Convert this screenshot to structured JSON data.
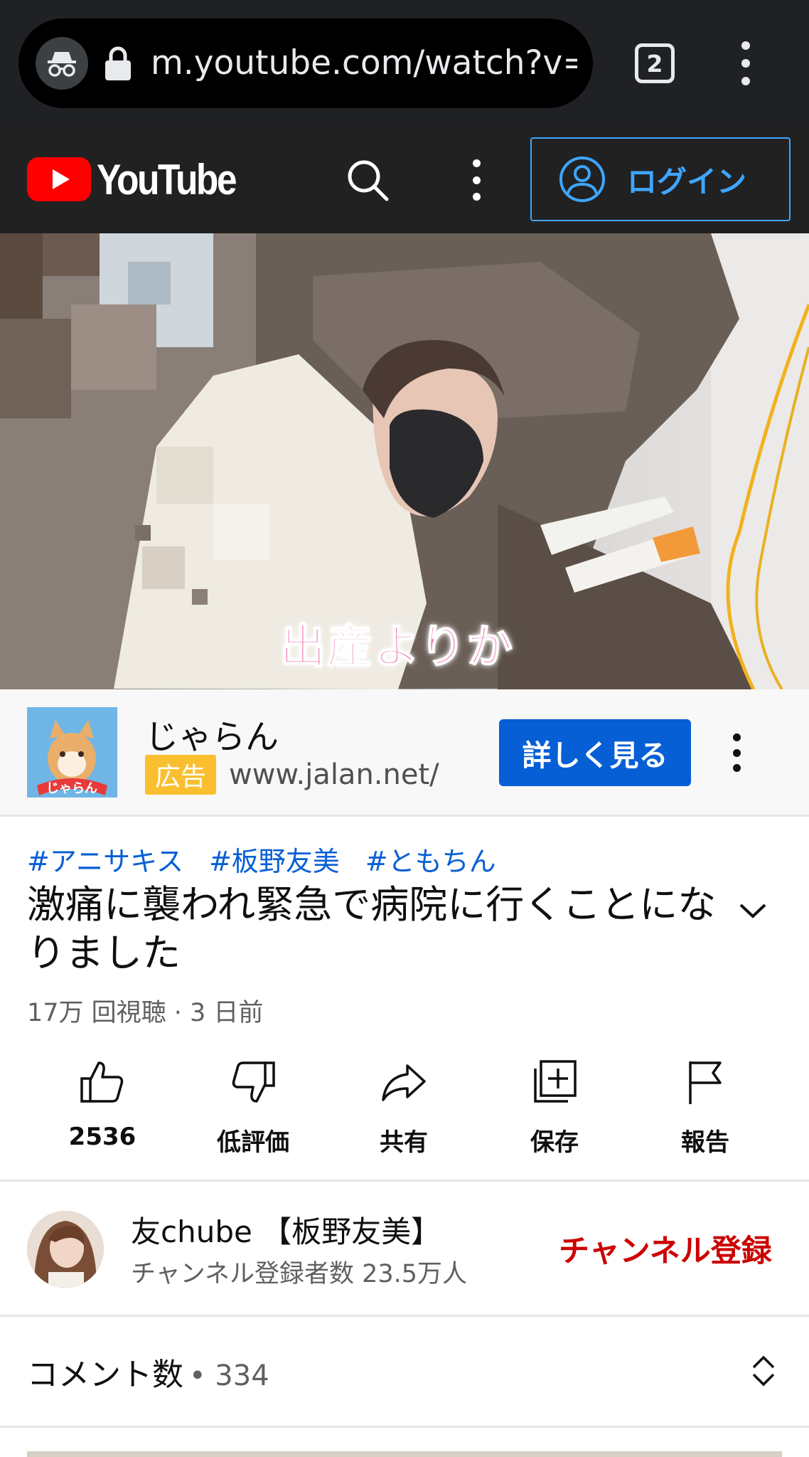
{
  "browser": {
    "url": "m.youtube.com/watch?v=h",
    "tab_count": "2",
    "icons": [
      "incognito-icon",
      "lock-icon",
      "tab-switcher-icon",
      "more-vert-icon"
    ]
  },
  "header": {
    "logo_text": "YouTube",
    "login_label": "ログイン",
    "accent": "#3ea6ff",
    "brand_red": "#ff0000"
  },
  "video": {
    "caption": "出産よりか"
  },
  "ad": {
    "title": "じゃらん",
    "badge": "広告",
    "url": "www.jalan.net/",
    "cta_label": "詳しく見る",
    "thumb_text": "じゃらん"
  },
  "info": {
    "hashtags": [
      "#アニサキス",
      "#板野友美",
      "#ともちん"
    ],
    "title": "激痛に襲われ緊急で病院に行くことになりました",
    "meta": "17万 回視聴 · 3 日前"
  },
  "actions": [
    {
      "icon": "like-icon",
      "label": "2536"
    },
    {
      "icon": "dislike-icon",
      "label": "低評価"
    },
    {
      "icon": "share-icon",
      "label": "共有"
    },
    {
      "icon": "save-icon",
      "label": "保存"
    },
    {
      "icon": "report-icon",
      "label": "報告"
    }
  ],
  "channel": {
    "name": "友chube 【板野友美】",
    "subscribers": "チャンネル登録者数 23.5万人",
    "subscribe_label": "チャンネル登録"
  },
  "comments": {
    "label": "コメント数",
    "count": "• 334"
  }
}
